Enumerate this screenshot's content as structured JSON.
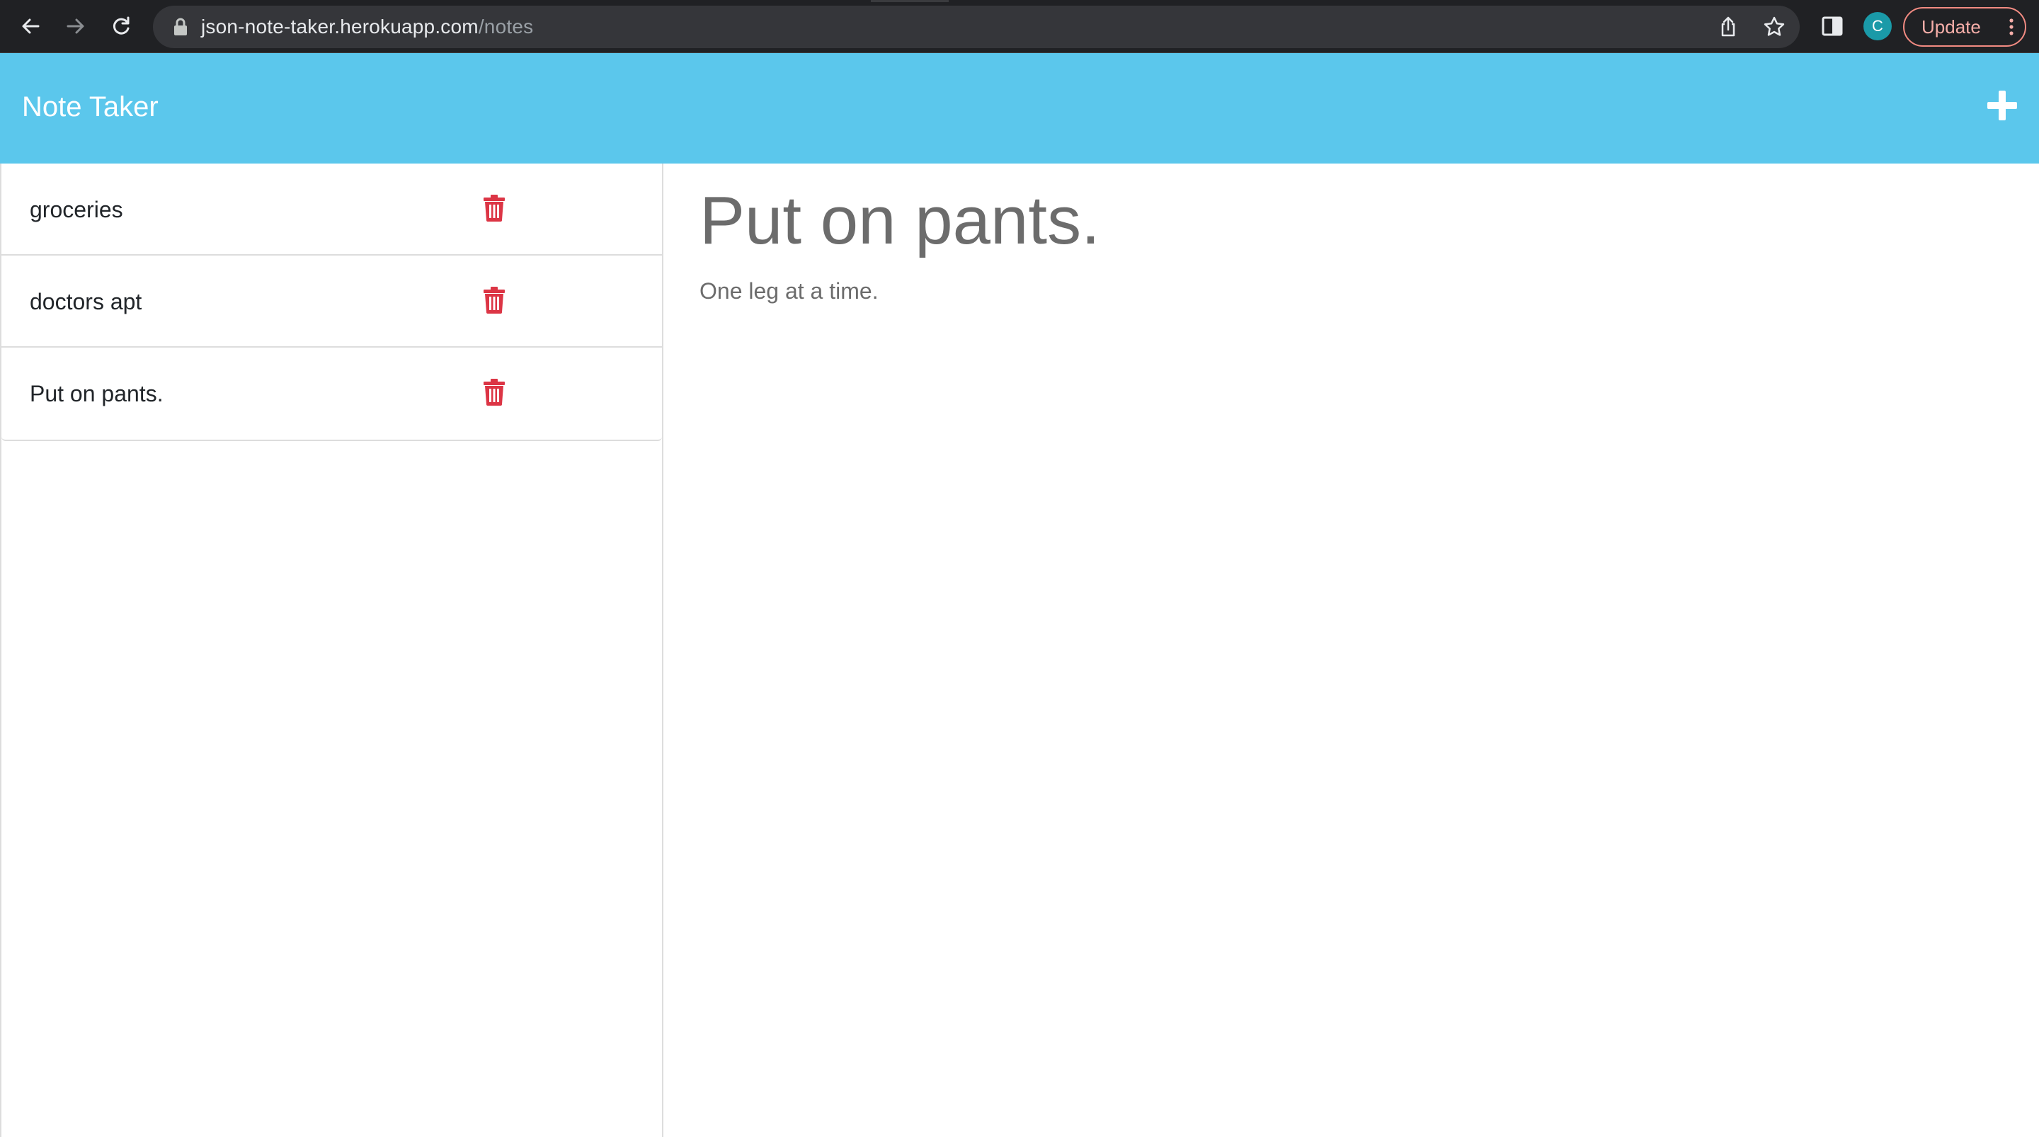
{
  "browser": {
    "url_host": "json-note-taker.herokuapp.com",
    "url_path": "/notes",
    "profile_initial": "C",
    "update_label": "Update"
  },
  "app": {
    "title": "Note Taker",
    "accent_color": "#5bc7ec",
    "delete_color": "#dc3545"
  },
  "notes": [
    {
      "title": "groceries"
    },
    {
      "title": "doctors apt"
    },
    {
      "title": "Put on pants."
    }
  ],
  "active_note": {
    "title": "Put on pants.",
    "text": "One leg at a time."
  },
  "icons": {
    "back": "arrow-left-icon",
    "forward": "arrow-right-icon",
    "reload": "reload-icon",
    "lock": "lock-icon",
    "share": "share-icon",
    "bookmark": "star-icon",
    "side_panel": "side-panel-icon",
    "menu": "kebab-menu-icon",
    "new_note": "plus-icon",
    "delete": "trash-icon"
  }
}
